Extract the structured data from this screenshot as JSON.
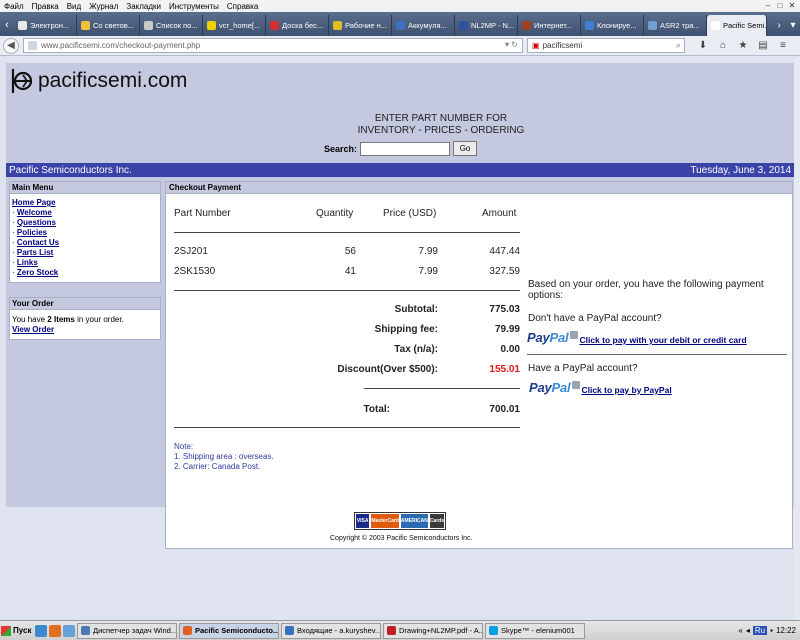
{
  "browser": {
    "menu": [
      "Файл",
      "Правка",
      "Вид",
      "Журнал",
      "Закладки",
      "Инструменты",
      "Справка"
    ],
    "tabs": [
      {
        "label": "Электрон...",
        "color": "#e8e8e8"
      },
      {
        "label": "Со светов...",
        "color": "#f0c040"
      },
      {
        "label": "Список по...",
        "color": "#c8c8c8"
      },
      {
        "label": "vcr_home[...",
        "color": "#f0d000"
      },
      {
        "label": "Доска бес...",
        "color": "#d03030"
      },
      {
        "label": "Рабочие н...",
        "color": "#e0c020"
      },
      {
        "label": "Аккумуля...",
        "color": "#4070c0"
      },
      {
        "label": "NL2MP - N...",
        "color": "#3050a0"
      },
      {
        "label": "Интернет...",
        "color": "#a04020"
      },
      {
        "label": "Клонируе...",
        "color": "#4080d0"
      },
      {
        "label": "ASR2 тра...",
        "color": "#70a0d0"
      },
      {
        "label": "Pacific Semi...",
        "color": "#ffffff",
        "active": true
      }
    ],
    "url": "www.pacificsemi.com/checkout-payment.php",
    "search_value": "pacificsemi"
  },
  "site": {
    "logo_text": "pacificsemi.com",
    "enter_line1": "ENTER PART NUMBER FOR",
    "enter_line2": "INVENTORY - PRICES - ORDERING",
    "search_label": "Search:",
    "search_button": "Go",
    "company": "Pacific Semiconductors Inc.",
    "date": "Tuesday, June 3, 2014"
  },
  "sidebar": {
    "menu_title": "Main Menu",
    "menu_items": [
      {
        "label": "Home Page",
        "prefix": ""
      },
      {
        "label": "Welcome",
        "prefix": "· "
      },
      {
        "label": "Questions",
        "prefix": "· "
      },
      {
        "label": "Policies",
        "prefix": "· "
      },
      {
        "label": "Contact Us",
        "prefix": "· "
      },
      {
        "label": "Parts List",
        "prefix": "· "
      },
      {
        "label": "Links",
        "prefix": "· "
      },
      {
        "label": "Zero Stock",
        "prefix": "· "
      }
    ],
    "order_title": "Your Order",
    "order_pre": "You have ",
    "order_count": "2 Items",
    "order_post": " in your order.",
    "view_order": "View Order"
  },
  "checkout": {
    "title": "Checkout Payment",
    "columns": {
      "part": "Part Number",
      "qty": "Quantity",
      "price": "Price (USD)",
      "amount": "Amount"
    },
    "rows": [
      {
        "part": "2SJ201",
        "qty": "56",
        "price": "7.99",
        "amount": "447.44"
      },
      {
        "part": "2SK1530",
        "qty": "41",
        "price": "7.99",
        "amount": "327.59"
      }
    ],
    "subtotal_label": "Subtotal:",
    "subtotal": "775.03",
    "shipping_label": "Shipping fee:",
    "shipping": "79.99",
    "tax_label": "Tax (n/a):",
    "tax": "0.00",
    "discount_label": "Discount(Over $500):",
    "discount": "155.01",
    "total_label": "Total:",
    "total": "700.01",
    "options_text": "Based on your order, you have the following payment options:",
    "no_paypal_q": "Don't have a PayPal account?",
    "card_link": "Click to pay with your debit or credit card",
    "have_paypal_q": "Have a PayPal account?",
    "paypal_link": "Click to pay by PayPal",
    "paypal_brand_1": "Pay",
    "paypal_brand_2": "Pal",
    "notes": [
      "Note:",
      "1. Shipping area : overseas.",
      "2. Carrier: Canada Post."
    ]
  },
  "footer": {
    "cards": [
      {
        "label": "VISA",
        "color": "#1a2a8a"
      },
      {
        "label": "MasterCard",
        "color": "#e05a10"
      },
      {
        "label": "AMERICAN EXPRESS",
        "color": "#2a6ab0"
      },
      {
        "label": "Cards",
        "color": "#3a3a3a"
      }
    ],
    "copyright": "Copyright © 2003 Pacific Semiconductors Inc."
  },
  "taskbar": {
    "start": "Пуск",
    "tasks": [
      {
        "label": "Диспетчер задач Wind...",
        "color": "#4a7ab0"
      },
      {
        "label": "Pacific Semiconducto...",
        "color": "#e06020",
        "active": true
      },
      {
        "label": "Входящие - a.kuryshev...",
        "color": "#3a70c0"
      },
      {
        "label": "Drawing+NL2MP.pdf - A...",
        "color": "#c02020"
      },
      {
        "label": "Skype™ - elenium001",
        "color": "#00a0e0"
      }
    ],
    "lang": "Ru",
    "clock": "12:22"
  }
}
